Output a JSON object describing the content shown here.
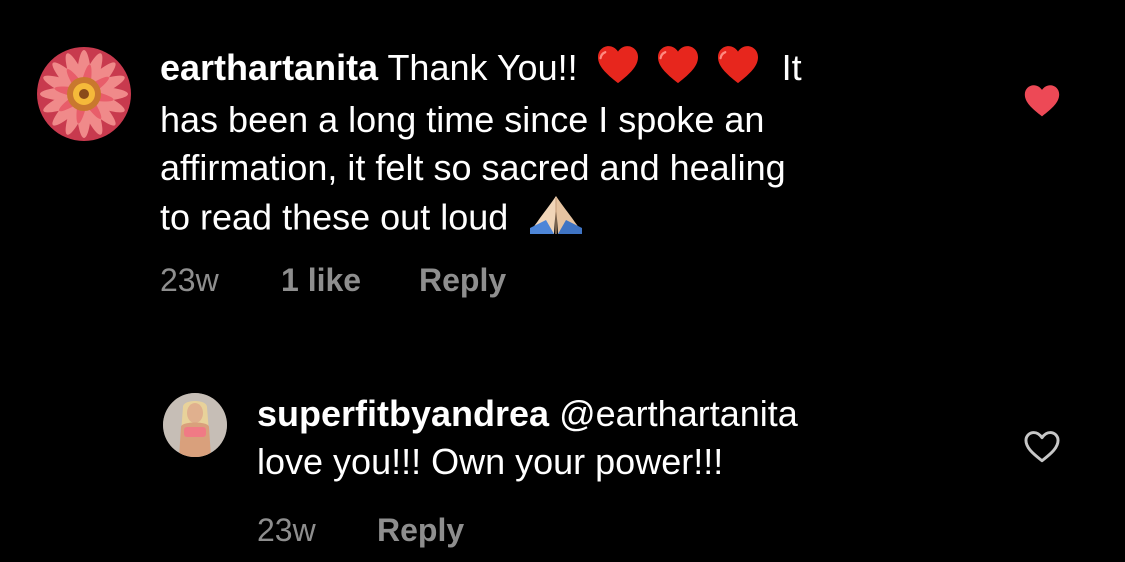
{
  "comments": [
    {
      "username": "earthartanita",
      "text_part1": "Thank You!!",
      "emoji_1": "heart-emoji",
      "text_part2": "It",
      "line2": "has been a long time since I spoke an",
      "line3": "affirmation, it felt so sacred and healing",
      "line4": "to read these out loud",
      "emoji_2": "folded-hands-emoji",
      "time": "23w",
      "likes": "1 like",
      "reply_label": "Reply",
      "liked": true,
      "avatar_icon": "flower-avatar"
    },
    {
      "username": "superfitbyandrea",
      "mention": "@earthartanita",
      "line2": "love you!!! Own your power!!!",
      "time": "23w",
      "reply_label": "Reply",
      "liked": false,
      "avatar_icon": "profile-photo-avatar"
    }
  ],
  "colors": {
    "background": "#000000",
    "text": "#ffffff",
    "meta": "#8e8e8e",
    "liked_heart": "#ed4956"
  }
}
